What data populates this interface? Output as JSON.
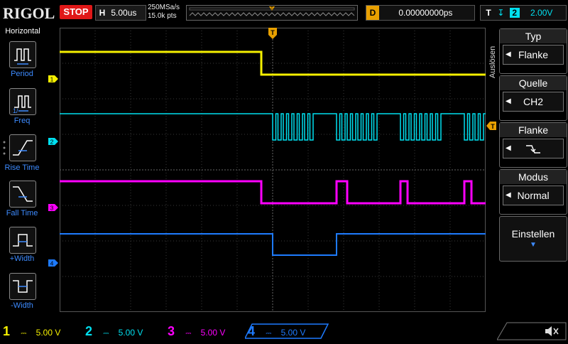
{
  "top": {
    "logo": "RIGOL",
    "run_state": "STOP",
    "horizontal_label": "H",
    "timebase": "5.00us",
    "sample_rate": "250MSa/s",
    "memory_depth": "15.0k pts",
    "delay_label": "D",
    "delay_value": "0.00000000ps",
    "trigger_label": "T",
    "trigger_channel": "2",
    "trigger_level": "2.00V"
  },
  "left_panel": {
    "title": "Horizontal",
    "items": [
      {
        "label": "Period",
        "icon": "period-icon"
      },
      {
        "label": "Freq",
        "icon": "freq-icon"
      },
      {
        "label": "Rise Time",
        "icon": "rise-time-icon"
      },
      {
        "label": "Fall Time",
        "icon": "fall-time-icon"
      },
      {
        "label": "+Width",
        "icon": "positive-width-icon"
      },
      {
        "label": "-Width",
        "icon": "negative-width-icon"
      }
    ]
  },
  "right_menu": {
    "side_label": "Auslösen",
    "items": [
      {
        "title": "Typ",
        "value": "Flanke"
      },
      {
        "title": "Quelle",
        "value": "CH2"
      },
      {
        "title": "Flanke",
        "value": "falling-edge-icon"
      },
      {
        "title": "Modus",
        "value": "Normal"
      },
      {
        "title": "Einstellen",
        "value": ""
      }
    ]
  },
  "channels": [
    {
      "num": "1",
      "scale": "5.00 V",
      "color": "#f5f000",
      "marker": "1"
    },
    {
      "num": "2",
      "scale": "5.00 V",
      "color": "#00e0f0",
      "marker": "2"
    },
    {
      "num": "3",
      "scale": "5.00 V",
      "color": "#ff00ff",
      "marker": "3"
    },
    {
      "num": "4",
      "scale": "5.00 V",
      "color": "#1e7bff",
      "marker": "4"
    }
  ],
  "trigger_marker": "T",
  "sound_icon": "speaker-muted-icon"
}
